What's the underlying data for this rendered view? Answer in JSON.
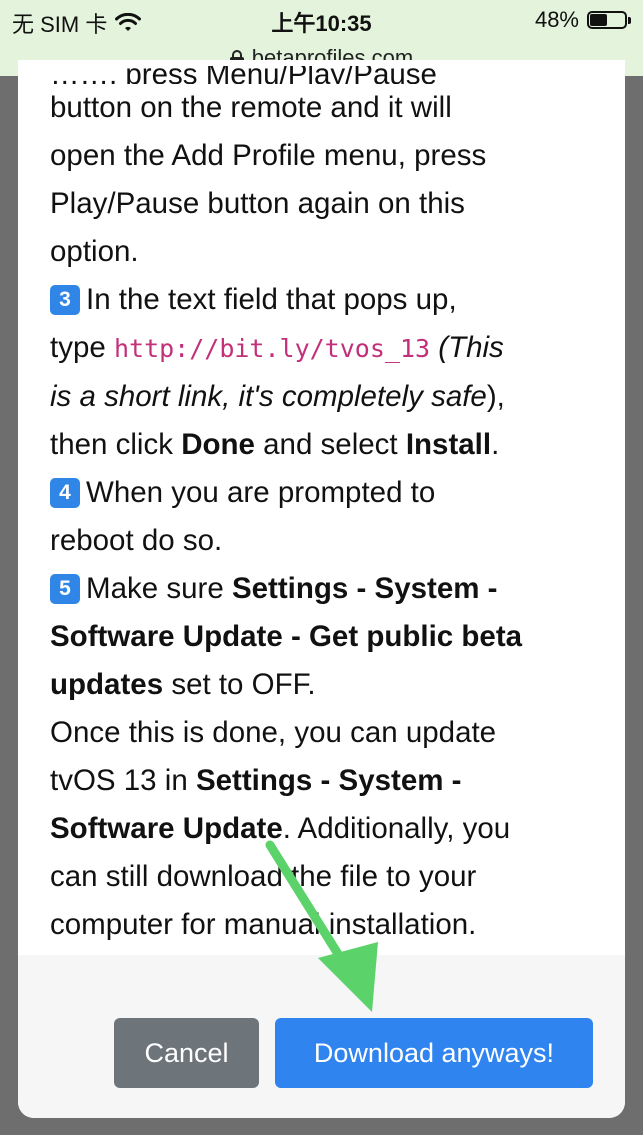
{
  "status_bar": {
    "carrier": "无 SIM 卡",
    "time": "上午10:35",
    "battery": "48%"
  },
  "url_bar": {
    "domain": "betaprofiles.com"
  },
  "icons": {
    "wifi": "wifi-icon",
    "battery": "battery-icon",
    "lock": "lock-icon",
    "arrow": "green-arrow-icon"
  },
  "colors": {
    "accent": "#2f84f0",
    "badge": "#2f86e6",
    "link": "#c3307a",
    "cancel": "#6d747a",
    "arrow": "#5cd26a",
    "status_bg": "#e3f3dc"
  },
  "content": {
    "cut_top": "……, press Menu/Play/Pause",
    "step2_lines": [
      "button on the remote and it will",
      "open the Add Profile menu, press",
      "Play/Pause button again on this",
      "option."
    ],
    "step3": {
      "num": "3",
      "text_a": "In the text field that pops up,",
      "text_b": "type",
      "link": "http://bit.ly/tvos_13",
      "italic_a": "(This",
      "italic_b": "is a short link, it's completely safe",
      "close_paren": ")",
      "text_c": ",",
      "text_d": "then click",
      "done": "Done",
      "text_e": "and select",
      "install": "Install",
      "text_f": "."
    },
    "step4": {
      "num": "4",
      "text_a": "When you are prompted to",
      "text_b": "reboot do so."
    },
    "step5": {
      "num": "5",
      "text_a": "Make sure",
      "bold_a": "Settings - System -",
      "bold_b": "Software Update - Get public beta",
      "bold_c": "updates",
      "text_b": "set to OFF."
    },
    "final": {
      "line1": "Once this is done, you can update",
      "text_a": "tvOS 13 in",
      "bold_a": "Settings - System -",
      "bold_b": "Software Update",
      "text_b": ". Additionally, you",
      "line4": "can still download the file to your",
      "line5": "computer for manual installation."
    }
  },
  "footer": {
    "cancel_label": "Cancel",
    "download_label": "Download anyways!"
  }
}
